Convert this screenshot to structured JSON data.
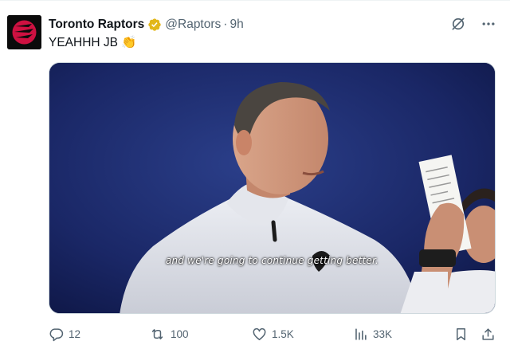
{
  "tweet": {
    "author": {
      "display_name": "Toronto Raptors",
      "handle": "@Raptors",
      "separator": "·",
      "time": "9h",
      "verified": true,
      "avatar_icon": "raptors-claw-logo"
    },
    "text": "YEAHHH JB",
    "emoji": "👏",
    "media": {
      "type": "video-still",
      "caption": "and we're going to continue getting better."
    },
    "header_icons": [
      "grok-icon",
      "more-icon"
    ],
    "actions": {
      "replies": "12",
      "reposts": "100",
      "likes": "1.5K",
      "views": "33K"
    }
  },
  "colors": {
    "text": "#0f1419",
    "secondary": "#536471",
    "verified_gold": "#e2b719",
    "brand_red": "#ce1141"
  }
}
